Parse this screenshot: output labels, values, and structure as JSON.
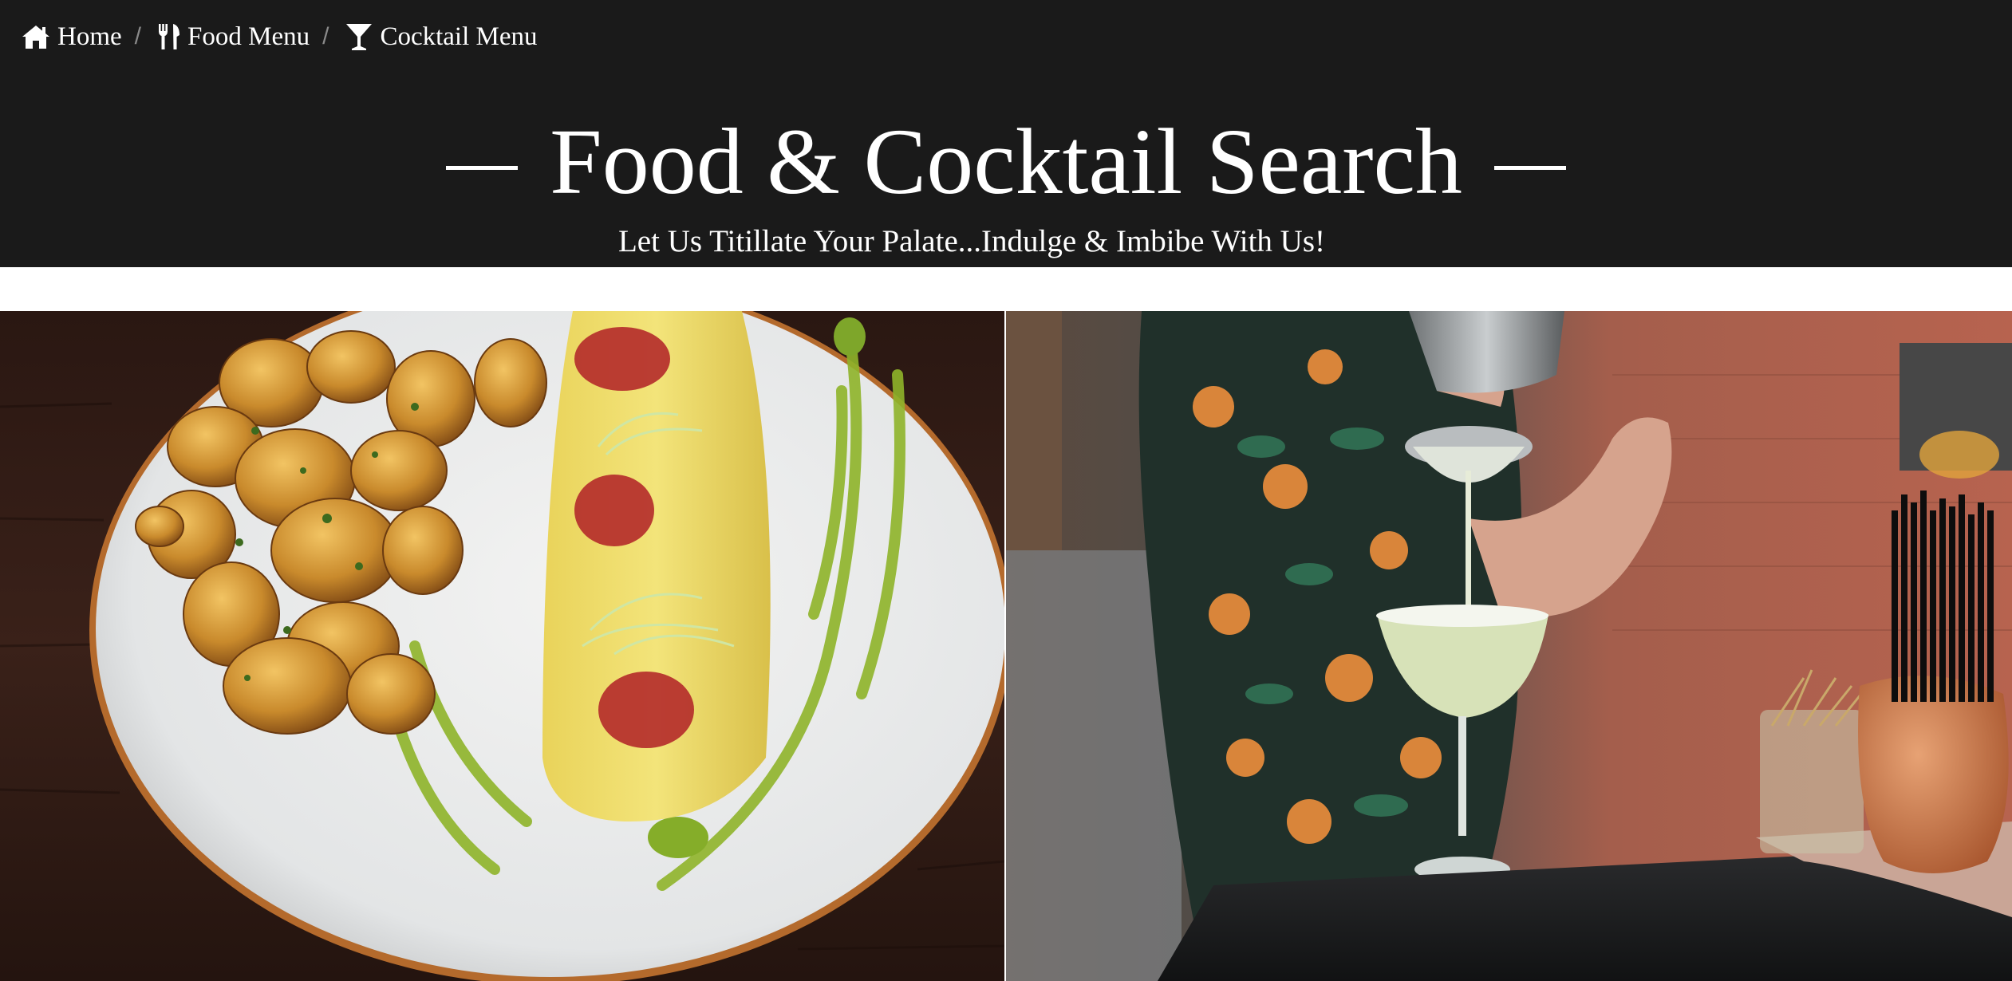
{
  "breadcrumb": {
    "items": [
      {
        "label": "Home",
        "icon": "home-icon"
      },
      {
        "label": "Food Menu",
        "icon": "utensils-icon"
      },
      {
        "label": "Cocktail Menu",
        "icon": "cocktail-glass-icon"
      }
    ],
    "separator": "/"
  },
  "hero": {
    "title": "Food & Cocktail Search",
    "subtitle": "Let Us Titillate Your Palate...Indulge & Imbibe With Us!"
  },
  "colors": {
    "header_background": "#1a1a1a",
    "header_text": "#ffffff",
    "separator": "#8a8a8a"
  }
}
